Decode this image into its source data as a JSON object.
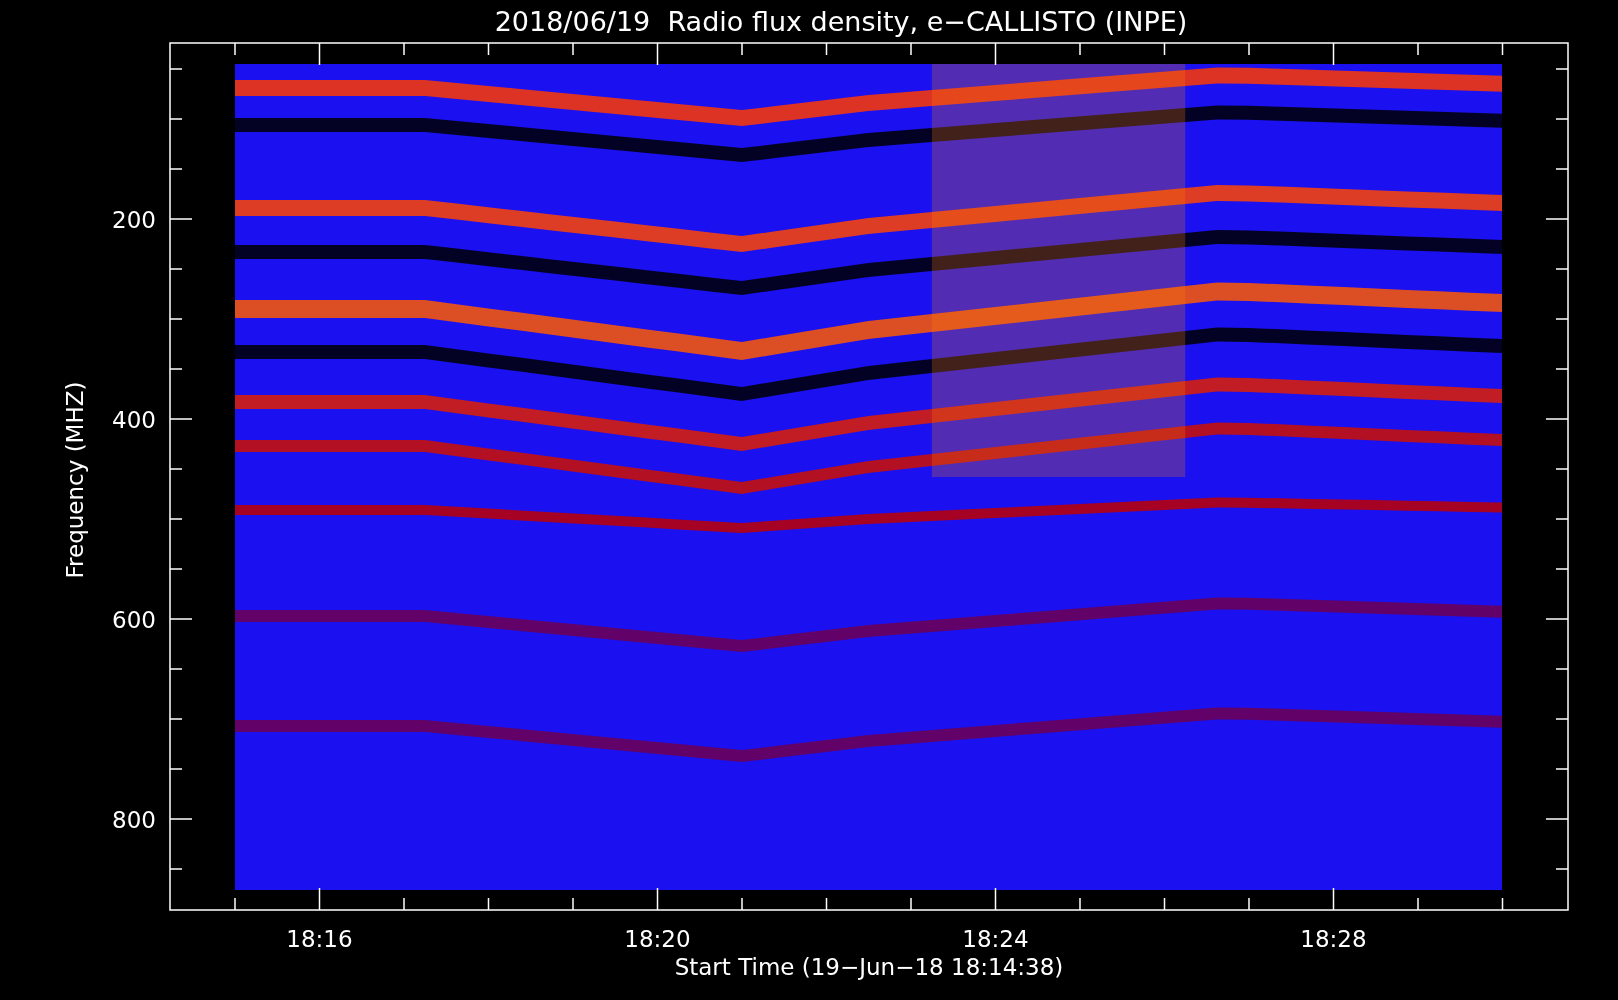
{
  "title": "2018/06/19  Radio flux density, e−CALLISTO (INPE)",
  "y_axis": {
    "label": "Frequency (MHZ)",
    "tick_labels": [
      "200",
      "400",
      "600",
      "800"
    ]
  },
  "x_axis": {
    "label": "Start Time (19−Jun−18 18:14:38)",
    "tick_labels": [
      "18:16",
      "18:20",
      "18:24",
      "18:28"
    ]
  }
}
